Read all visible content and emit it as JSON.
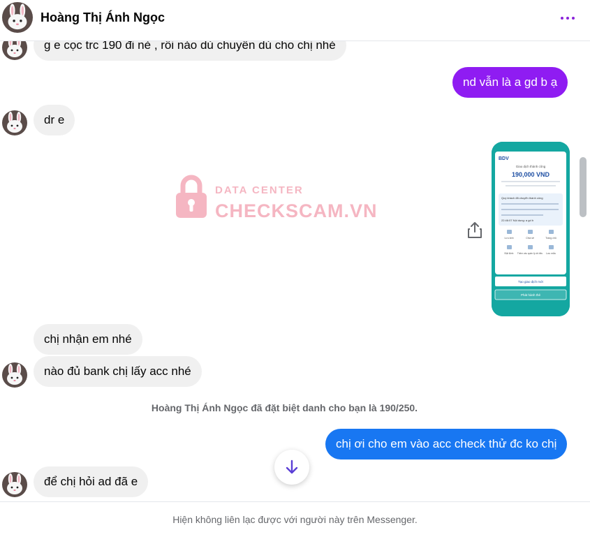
{
  "header": {
    "contact_name": "Hoàng Thị Ánh Ngọc",
    "more_icon": "more-dots-icon"
  },
  "messages": [
    {
      "text": "g e cọc trc 190 đi nè , rồi nào dủ chuyển dủ cho chị nhé"
    },
    {
      "text": "nd vẫn là a gd b ạ"
    },
    {
      "text": "dr e"
    },
    {
      "text": "chị nhận em nhé"
    },
    {
      "text": "nào đủ bank chị lấy acc nhé"
    },
    {
      "text": "chị ơi cho em vào acc check thử đc ko chị"
    },
    {
      "text": "để chị hỏi ad đã e"
    }
  ],
  "photo": {
    "bank": "BDV",
    "title": "Giao dịch thành công",
    "amount": "190,000 VND",
    "note": "Quý khách đã chuyển thành công",
    "note_end": "22:46:07 Nội dung: a gd b",
    "actions": [
      "Lưu ảnh",
      "Chia sẻ",
      "Trang chủ",
      "Đặt lệnh",
      "Thêm vào quản lý chi tiêu",
      "Lưu mẫu"
    ],
    "new_transaction": "Tạo giao dịch mới",
    "issue_card": "Phát hành thẻ"
  },
  "watermark": {
    "line1": "DATA CENTER",
    "line2": "CHECKSCAM.VN"
  },
  "system_note": "Hoàng Thị Ánh Ngọc đã đặt biệt danh cho bạn là 190/250.",
  "footer_text": "Hiện không liên lạc được với người này trên Messenger.",
  "colors": {
    "purple_bubble": "#8f1cf2",
    "blue_bubble": "#1877f2",
    "incoming_bubble": "#f0f0f0"
  }
}
